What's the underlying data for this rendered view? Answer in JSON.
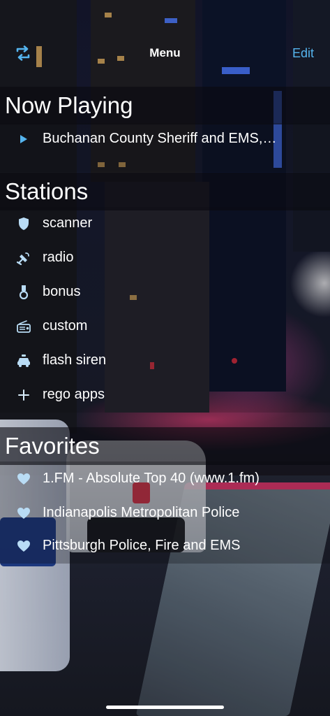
{
  "nav": {
    "title": "Menu",
    "edit_label": "Edit",
    "refresh_icon": "refresh-icon"
  },
  "now_playing": {
    "header": "Now Playing",
    "item": {
      "label": "Buchanan County Sheriff and EMS,…",
      "icon": "play-icon"
    }
  },
  "stations": {
    "header": "Stations",
    "items": [
      {
        "label": "scanner",
        "icon": "shield-icon"
      },
      {
        "label": "radio",
        "icon": "satellite-icon"
      },
      {
        "label": "bonus",
        "icon": "medal-icon"
      },
      {
        "label": "custom",
        "icon": "radio-device-icon"
      },
      {
        "label": "flash siren",
        "icon": "police-car-icon"
      },
      {
        "label": "rego apps",
        "icon": "plus-icon"
      }
    ]
  },
  "favorites": {
    "header": "Favorites",
    "items": [
      {
        "label": "1.FM - Absolute Top 40 (www.1.fm)",
        "icon": "heart-icon"
      },
      {
        "label": "Indianapolis Metropolitan Police",
        "icon": "heart-icon"
      },
      {
        "label": "Pittsburgh Police, Fire and EMS",
        "icon": "heart-icon"
      }
    ]
  },
  "colors": {
    "accent": "#55b4ee",
    "text": "#ffffff",
    "header_band": "#0a0a10"
  }
}
